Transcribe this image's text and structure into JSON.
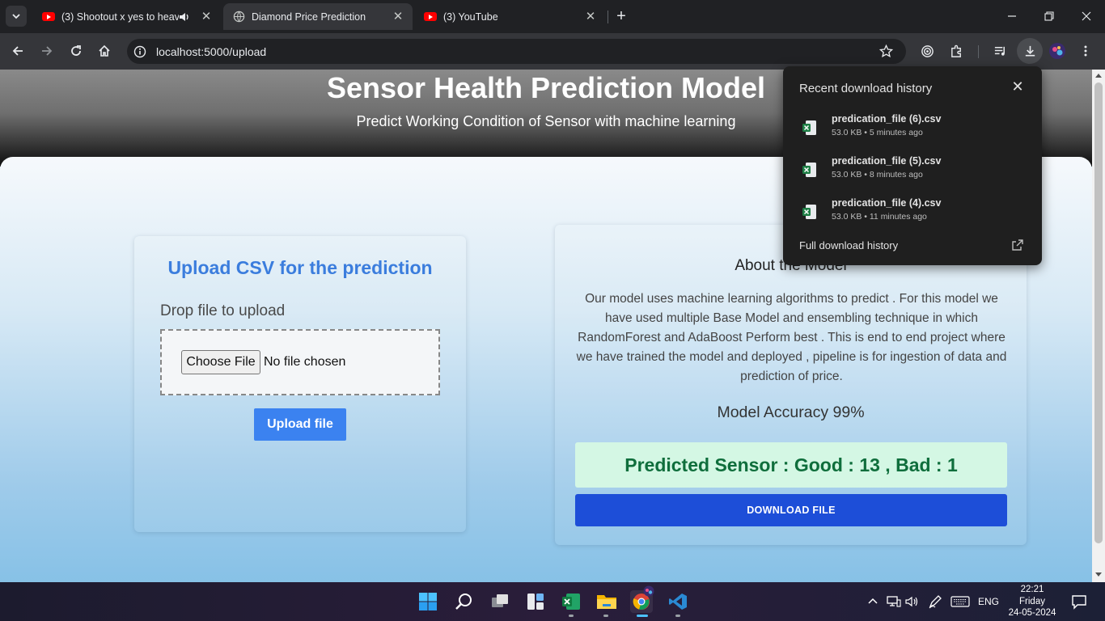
{
  "tabs": [
    {
      "title": "(3) Shootout x yes to heave",
      "icon": "youtube-icon",
      "audio": true
    },
    {
      "title": "Diamond Price Prediction",
      "icon": "globe-icon",
      "active": true
    },
    {
      "title": "(3) YouTube",
      "icon": "youtube-icon"
    }
  ],
  "toolbar": {
    "url": "localhost:5000/upload"
  },
  "page": {
    "title": "Sensor Health Prediction Model",
    "subtitle": "Predict Working Condition of Sensor with machine learning",
    "upload": {
      "heading": "Upload CSV for the prediction",
      "drop_label": "Drop file to upload",
      "choose_file": "Choose File",
      "no_file": "No file chosen",
      "upload_button": "Upload file"
    },
    "about": {
      "heading": "About the Model",
      "body": "Our model uses machine learning algorithms to predict . For this model we have used multiple Base Model and ensembling technique in which RandomForest and AdaBoost Perform best . This is end to end project where we have trained the model and deployed , pipeline is for ingestion of data and prediction of price.",
      "accuracy": "Model Accuracy 99%",
      "result": "Predicted Sensor : Good : 13 , Bad : 1",
      "download_button": "DOWNLOAD FILE"
    }
  },
  "downloads": {
    "heading": "Recent download history",
    "items": [
      {
        "name": "predication_file (6).csv",
        "meta": "53.0 KB • 5 minutes ago"
      },
      {
        "name": "predication_file (5).csv",
        "meta": "53.0 KB • 8 minutes ago"
      },
      {
        "name": "predication_file (4).csv",
        "meta": "53.0 KB • 11 minutes ago"
      }
    ],
    "footer": "Full download history"
  },
  "taskbar": {
    "language": "ENG",
    "time": "22:21",
    "day": "Friday",
    "date": "24-05-2024"
  },
  "colors": {
    "accent_blue": "#3b82f0",
    "download_button": "#1d4ed8",
    "result_bg": "#d4f7e4",
    "result_text": "#0f6e3c"
  }
}
